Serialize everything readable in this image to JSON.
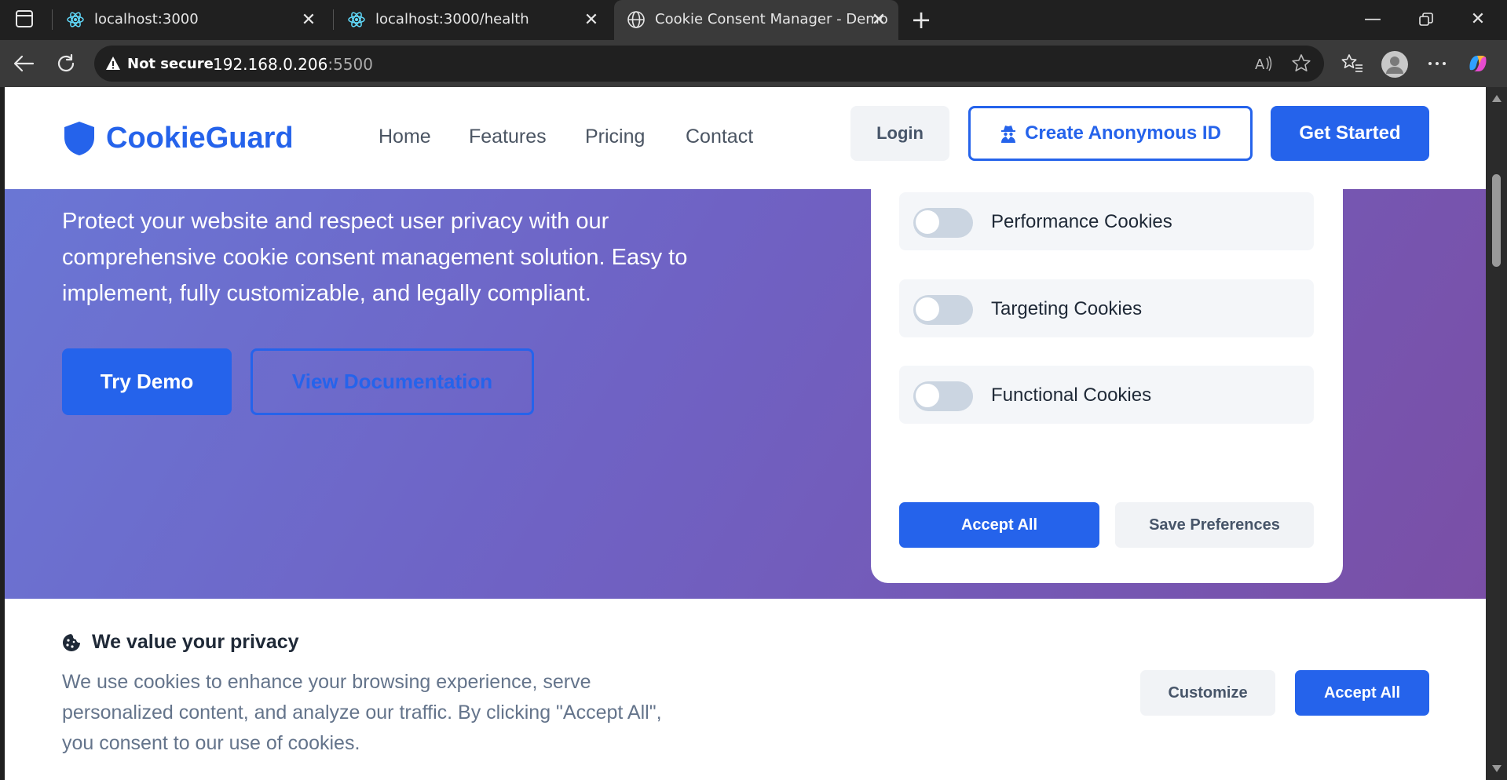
{
  "browser": {
    "tabs": [
      {
        "title": "localhost:3000",
        "icon": "react-icon"
      },
      {
        "title": "localhost:3000/health",
        "icon": "react-icon"
      },
      {
        "title": "Cookie Consent Manager - Demo",
        "icon": "globe-icon",
        "active": true
      }
    ],
    "security_label": "Not secure",
    "url_host": "192.168.0.206",
    "url_port": ":5500"
  },
  "site": {
    "brand": "CookieGuard",
    "brand_color": "#2563eb",
    "nav": [
      "Home",
      "Features",
      "Pricing",
      "Contact"
    ],
    "login_label": "Login",
    "anon_label": "Create Anonymous ID",
    "get_started_label": "Get Started"
  },
  "hero": {
    "text": "Protect your website and respect user privacy with our comprehensive cookie consent management solution. Easy to implement, fully customizable, and legally compliant.",
    "try_demo": "Try Demo",
    "view_docs": "View Documentation"
  },
  "preferences": {
    "items": [
      {
        "label": "Performance Cookies",
        "enabled": false
      },
      {
        "label": "Targeting Cookies",
        "enabled": false
      },
      {
        "label": "Functional Cookies",
        "enabled": false
      }
    ],
    "accept_all": "Accept All",
    "save": "Save Preferences"
  },
  "banner": {
    "title": "We value your privacy",
    "text": "We use cookies to enhance your browsing experience, serve personalized content, and analyze our traffic. By clicking \"Accept All\", you consent to our use of cookies.",
    "customize": "Customize",
    "accept_all": "Accept All"
  }
}
